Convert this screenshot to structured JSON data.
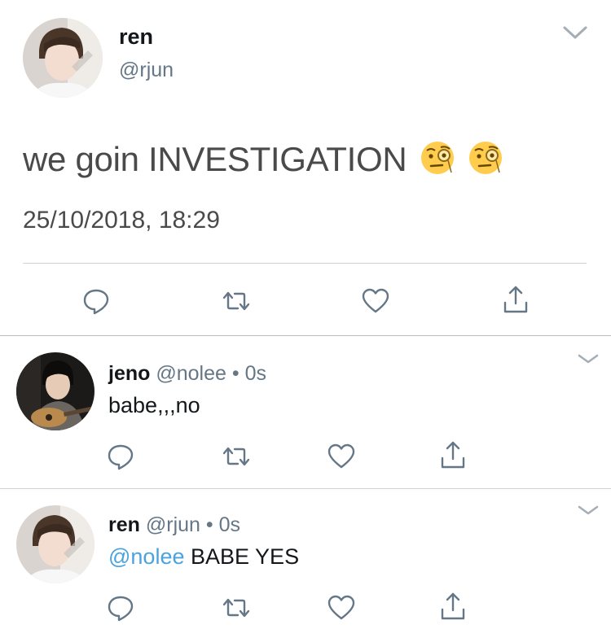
{
  "main_tweet": {
    "name": "ren",
    "handle": "@rjun",
    "text": "we goin INVESTIGATION",
    "emoji": [
      "face-with-monocle-icon",
      "face-with-monocle-icon"
    ],
    "timestamp": "25/10/2018, 18:29",
    "actions": [
      "reply-icon",
      "retweet-icon",
      "like-icon",
      "share-icon"
    ]
  },
  "replies": [
    {
      "name": "jeno",
      "handle": "@nolee",
      "separator": "•",
      "time": "0s",
      "mention": "",
      "text": "babe,,,no"
    },
    {
      "name": "ren",
      "handle": "@rjun",
      "separator": "•",
      "time": "0s",
      "mention": "@nolee",
      "text": "BABE YES"
    }
  ],
  "colors": {
    "text": "#14171a",
    "secondary": "#657786",
    "link": "#4aa3df",
    "divider": "#cfd3d6"
  }
}
